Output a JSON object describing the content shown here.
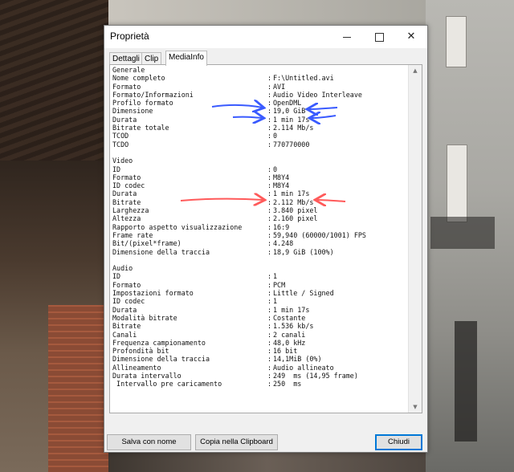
{
  "window": {
    "title": "Proprietà",
    "minimize_glyph": "—",
    "close_glyph": "✕"
  },
  "tabs": [
    {
      "label": "Dettagli",
      "active": false
    },
    {
      "label": "Clip",
      "active": false
    },
    {
      "label": "MediaInfo",
      "active": true
    }
  ],
  "mediainfo": {
    "rows": [
      {
        "label": "Generale",
        "value": null
      },
      {
        "label": "Nome completo",
        "value": "F:\\Untitled.avi"
      },
      {
        "label": "Formato",
        "value": "AVI"
      },
      {
        "label": "Formato/Informazioni",
        "value": "Audio Video Interleave"
      },
      {
        "label": "Profilo formato",
        "value": "OpenDML"
      },
      {
        "label": "Dimensione",
        "value": "19,0 GiB"
      },
      {
        "label": "Durata",
        "value": "1 min 17s"
      },
      {
        "label": "Bitrate totale",
        "value": "2.114 Mb/s"
      },
      {
        "label": "TCOD",
        "value": "0"
      },
      {
        "label": "TCDO",
        "value": "770770000"
      },
      {
        "label": "",
        "value": null
      },
      {
        "label": "Video",
        "value": null
      },
      {
        "label": "ID",
        "value": "0"
      },
      {
        "label": "Formato",
        "value": "M8Y4"
      },
      {
        "label": "ID codec",
        "value": "M8Y4"
      },
      {
        "label": "Durata",
        "value": "1 min 17s"
      },
      {
        "label": "Bitrate",
        "value": "2.112 Mb/s"
      },
      {
        "label": "Larghezza",
        "value": "3.840 pixel"
      },
      {
        "label": "Altezza",
        "value": "2.160 pixel"
      },
      {
        "label": "Rapporto aspetto visualizzazione",
        "value": "16:9"
      },
      {
        "label": "Frame rate",
        "value": "59,940 (60000/1001) FPS"
      },
      {
        "label": "Bit/(pixel*frame)",
        "value": "4.248"
      },
      {
        "label": "Dimensione della traccia",
        "value": "18,9 GiB (100%)"
      },
      {
        "label": "",
        "value": null
      },
      {
        "label": "Audio",
        "value": null
      },
      {
        "label": "ID",
        "value": "1"
      },
      {
        "label": "Formato",
        "value": "PCM"
      },
      {
        "label": "Impostazioni formato",
        "value": "Little / Signed"
      },
      {
        "label": "ID codec",
        "value": "1"
      },
      {
        "label": "Durata",
        "value": "1 min 17s"
      },
      {
        "label": "Modalità bitrate",
        "value": "Costante"
      },
      {
        "label": "Bitrate",
        "value": "1.536 kb/s"
      },
      {
        "label": "Canali",
        "value": "2 canali"
      },
      {
        "label": "Frequenza campionamento",
        "value": "48,0 kHz"
      },
      {
        "label": "Profondità bit",
        "value": "16 bit"
      },
      {
        "label": "Dimensione della traccia",
        "value": "14,1MiB (0%)"
      },
      {
        "label": "Allineamento",
        "value": "Audio allineato"
      },
      {
        "label": "Durata intervallo",
        "value": "249  ms (14,95 frame)"
      },
      {
        "label": " Intervallo pre caricamento",
        "value": "250  ms"
      }
    ]
  },
  "buttons": {
    "save": "Salva con nome",
    "copy": "Copia nella Clipboard",
    "close": "Chiudi"
  },
  "annotations": {
    "blue_arrow_color": "#3a5bff",
    "red_arrow_color": "#ff5a5a"
  }
}
